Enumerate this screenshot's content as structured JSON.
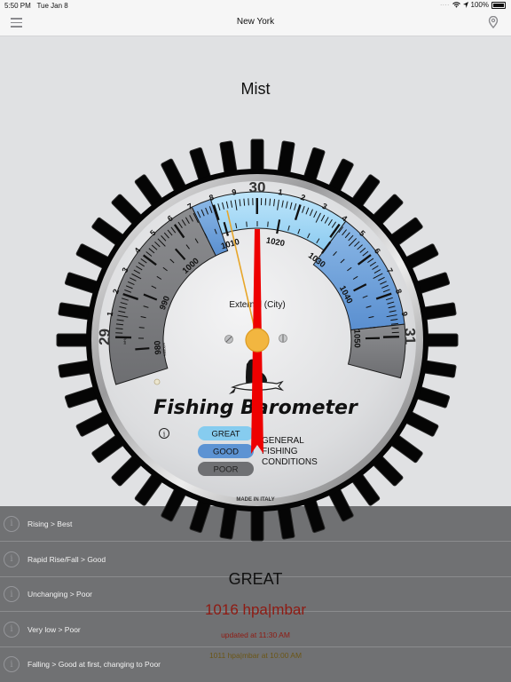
{
  "status_bar": {
    "time": "5:50 PM",
    "date": "Tue Jan 8",
    "battery": "100%",
    "icons": [
      "signal-dots-icon",
      "wifi-icon",
      "location-arrow-icon",
      "battery-icon"
    ]
  },
  "nav": {
    "title": "New York",
    "left_icon": "hamburger-menu-icon",
    "right_icon": "location-pin-icon"
  },
  "weather": {
    "condition": "Mist"
  },
  "dial": {
    "brand": "Fishing Barometer",
    "sublabel": "External (City)",
    "made_in": "MADE IN ITALY",
    "unit_inhg": "inHg",
    "unit_mbar": "Millibars",
    "current_hpa": 1016,
    "reference_hpa": 1011,
    "hpa_labels": [
      980,
      990,
      1000,
      1010,
      1020,
      1030,
      1040,
      1050
    ],
    "inhg_major": [
      {
        "label": "29",
        "hpa": 982.1
      },
      {
        "label": "1",
        "hpa": 985.5
      },
      {
        "label": "2",
        "hpa": 988.9
      },
      {
        "label": "3",
        "hpa": 992.3
      },
      {
        "label": "4",
        "hpa": 995.7
      },
      {
        "label": "5",
        "hpa": 999.1
      },
      {
        "label": "6",
        "hpa": 1002.4
      },
      {
        "label": "7",
        "hpa": 1005.8
      },
      {
        "label": "8",
        "hpa": 1009.2
      },
      {
        "label": "9",
        "hpa": 1012.6
      },
      {
        "label": "30",
        "hpa": 1016.0
      },
      {
        "label": "1",
        "hpa": 1019.4
      },
      {
        "label": "2",
        "hpa": 1022.8
      },
      {
        "label": "3",
        "hpa": 1026.2
      },
      {
        "label": "4",
        "hpa": 1029.6
      },
      {
        "label": "5",
        "hpa": 1033.0
      },
      {
        "label": "6",
        "hpa": 1036.4
      },
      {
        "label": "7",
        "hpa": 1039.8
      },
      {
        "label": "8",
        "hpa": 1043.1
      },
      {
        "label": "9",
        "hpa": 1046.5
      },
      {
        "label": "31",
        "hpa": 1049.8
      }
    ],
    "zones": [
      {
        "name": "poor",
        "from": 975,
        "to": 1006,
        "color": "#7b7c7f"
      },
      {
        "name": "good",
        "from": 1006,
        "to": 1009,
        "color": "#6b9fd8"
      },
      {
        "name": "great",
        "from": 1009,
        "to": 1030,
        "color": "#9fd4f4"
      },
      {
        "name": "good",
        "from": 1030,
        "to": 1048,
        "color": "#6b9fd8"
      },
      {
        "name": "poor",
        "from": 1048,
        "to": 1056,
        "color": "#7b7c7f"
      }
    ],
    "legend": {
      "great": "GREAT",
      "good": "GOOD",
      "poor": "POOR",
      "caption": [
        "GENERAL",
        "FISHING",
        "CONDITIONS"
      ],
      "colors": {
        "great": "#86ccef",
        "good": "#5d93d3",
        "poor": "#6f7073"
      }
    },
    "needle_color": "#ee0000",
    "ref_needle_color": "#e7a629",
    "hub_color": "#f2b640"
  },
  "rules": [
    {
      "label": "Rising > Best"
    },
    {
      "label": "Rapid Rise/Fall > Good"
    },
    {
      "label": "Unchanging > Poor"
    },
    {
      "label": "Very low > Poor"
    },
    {
      "label": "Falling > Good at first, changing to Poor"
    }
  ],
  "readout": {
    "status": "GREAT",
    "pressure": "1016 hpa|mbar",
    "updated": "updated at 11:30 AM",
    "previous": "1011 hpa|mbar at 10:00 AM"
  }
}
